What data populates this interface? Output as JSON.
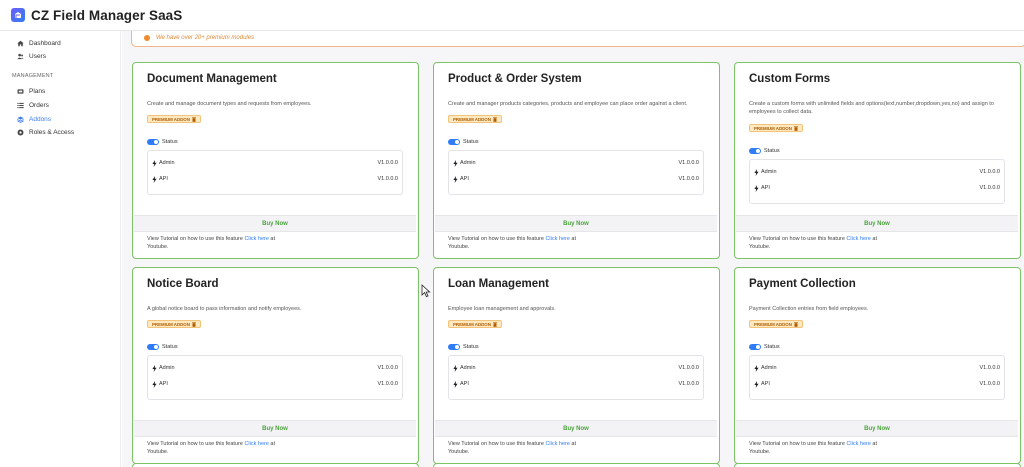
{
  "app": {
    "title": "CZ Field Manager SaaS"
  },
  "sidebar": {
    "items_top": [
      {
        "label": "Dashboard",
        "icon": "home-icon"
      },
      {
        "label": "Users",
        "icon": "users-icon"
      }
    ],
    "section_label": "MANAGEMENT",
    "items_mgmt": [
      {
        "label": "Plans",
        "icon": "plans-icon"
      },
      {
        "label": "Orders",
        "icon": "list-icon"
      },
      {
        "label": "Addons",
        "icon": "stack-icon",
        "active": true
      },
      {
        "label": "Roles & Access",
        "icon": "settings-icon"
      }
    ]
  },
  "alert": {
    "text": "We have over 20+ premium modules"
  },
  "colors": {
    "accent": "#3d7ff5",
    "card_border": "#7cc466",
    "buy_text": "#4aa23a",
    "badge_bg": "#ffe9c2",
    "badge_text": "#b05c00"
  },
  "cards": [
    {
      "title": "Document Management",
      "description": "Create and manage document types and requests from employees.",
      "badge": "PREMIUM ADDON",
      "status_label": "Status",
      "modules": [
        {
          "name": "Admin",
          "version": "V1.0.0.0"
        },
        {
          "name": "API",
          "version": "V1.0.0.0"
        }
      ],
      "buy_label": "Buy Now",
      "tutorial_prefix": "View Tutorial on how to use this feature",
      "tutorial_link": "Click here",
      "tutorial_suffix": "at Youtube."
    },
    {
      "title": "Product & Order System",
      "description": "Create and manager products categories, products and employee can place order against a client.",
      "badge": "PREMIUM ADDON",
      "status_label": "Status",
      "modules": [
        {
          "name": "Admin",
          "version": "V1.0.0.0"
        },
        {
          "name": "API",
          "version": "V1.0.0.0"
        }
      ],
      "buy_label": "Buy Now",
      "tutorial_prefix": "View Tutorial on how to use this feature",
      "tutorial_link": "Click here",
      "tutorial_suffix": "at Youtube."
    },
    {
      "title": "Custom Forms",
      "description": "Create a custom forms with unlimited fields and options(text,number,dropdown,yes,no) and assign to employees to collect data.",
      "badge": "PREMIUM ADDON",
      "status_label": "Status",
      "modules": [
        {
          "name": "Admin",
          "version": "V1.0.0.0"
        },
        {
          "name": "API",
          "version": "V1.0.0.0"
        }
      ],
      "buy_label": "Buy Now",
      "tutorial_prefix": "View Tutorial on how to use this feature",
      "tutorial_link": "Click here",
      "tutorial_suffix": "at Youtube."
    },
    {
      "title": "Notice Board",
      "description": "A global notice board to pass information and notify employees.",
      "badge": "PREMIUM ADDON",
      "status_label": "Status",
      "modules": [
        {
          "name": "Admin",
          "version": "V1.0.0.0"
        },
        {
          "name": "API",
          "version": "V1.0.0.0"
        }
      ],
      "buy_label": "Buy Now",
      "tutorial_prefix": "View Tutorial on how to use this feature",
      "tutorial_link": "Click here",
      "tutorial_suffix": "at Youtube."
    },
    {
      "title": "Loan Management",
      "description": "Employee loan management and approvals.",
      "badge": "PREMIUM ADDON",
      "status_label": "Status",
      "modules": [
        {
          "name": "Admin",
          "version": "V1.0.0.0"
        },
        {
          "name": "API",
          "version": "V1.0.0.0"
        }
      ],
      "buy_label": "Buy Now",
      "tutorial_prefix": "View Tutorial on how to use this feature",
      "tutorial_link": "Click here",
      "tutorial_suffix": "at Youtube."
    },
    {
      "title": "Payment Collection",
      "description": "Payment Collection entries from field employees.",
      "badge": "PREMIUM ADDON",
      "status_label": "Status",
      "modules": [
        {
          "name": "Admin",
          "version": "V1.0.0.0"
        },
        {
          "name": "API",
          "version": "V1.0.0.0"
        }
      ],
      "buy_label": "Buy Now",
      "tutorial_prefix": "View Tutorial on how to use this feature",
      "tutorial_link": "Click here",
      "tutorial_suffix": "at Youtube."
    }
  ]
}
